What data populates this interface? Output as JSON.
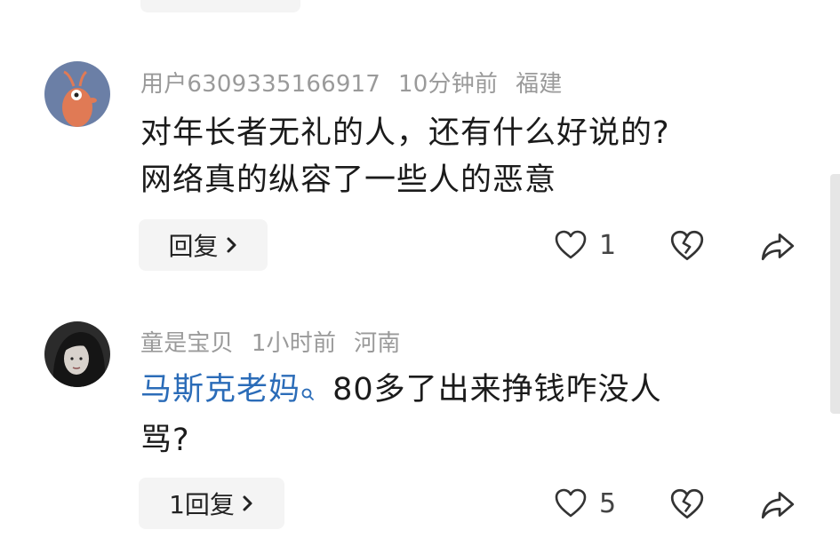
{
  "comments": [
    {
      "username": "用户6309335166917",
      "time": "10分钟前",
      "location": "福建",
      "line1": "对年长者无礼的人，还有什么好说的?",
      "line2": "网络真的纵容了一些人的恶意",
      "reply_label": "回复",
      "like_count": "1",
      "avatar_icon": "cartoon-shrimp-avatar"
    },
    {
      "username": "童是宝贝",
      "time": "1小时前",
      "location": "河南",
      "mention": "马斯克老妈",
      "text_after_mention": " 80多了出来挣钱咋没人",
      "line2": "骂?",
      "reply_label": "1回复",
      "like_count": "5",
      "avatar_icon": "woman-portrait-avatar"
    }
  ],
  "colors": {
    "meta": "#9a9a9a",
    "mention": "#2b6cb8",
    "button_bg": "#f4f4f4"
  }
}
